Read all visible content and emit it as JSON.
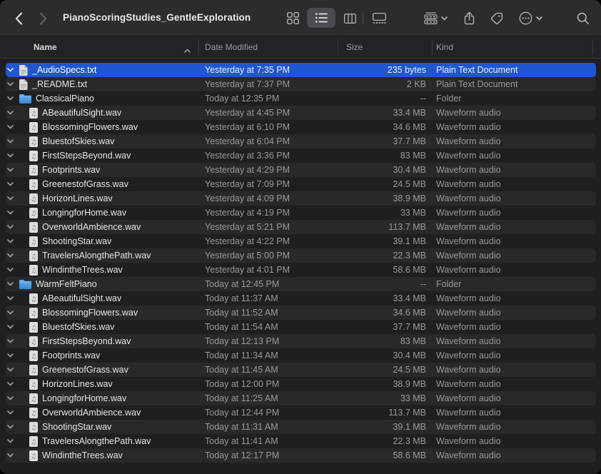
{
  "window": {
    "title": "PianoScoringStudies_GentleExploration"
  },
  "toolbar": {
    "buttons": [
      {
        "name": "back",
        "icon": "chevron-left-icon"
      },
      {
        "name": "forward",
        "icon": "chevron-right-icon",
        "disabled": true
      },
      {
        "name": "icon-view",
        "icon": "grid-view-icon"
      },
      {
        "name": "list-view",
        "icon": "list-view-icon",
        "active": true
      },
      {
        "name": "column-view",
        "icon": "column-view-icon"
      },
      {
        "name": "gallery-view",
        "icon": "gallery-view-icon"
      },
      {
        "name": "group",
        "icon": "group-icon",
        "has_dropdown_chevron": true
      },
      {
        "name": "share",
        "icon": "share-icon"
      },
      {
        "name": "tags",
        "icon": "tag-icon"
      },
      {
        "name": "more-options",
        "icon": "ellipsis-circle-icon",
        "has_dropdown_chevron": true
      },
      {
        "name": "search",
        "icon": "search-icon"
      }
    ]
  },
  "columns": [
    {
      "label": "Name",
      "sort": "ascending"
    },
    {
      "label": "Date Modified"
    },
    {
      "label": "Size"
    },
    {
      "label": "Kind"
    }
  ],
  "rows": [
    {
      "name": "_AudioSpecs.txt",
      "icon": "plain-text-document",
      "indent": 0,
      "date": "Yesterday at 7:35 PM",
      "size": "235 bytes",
      "kind": "Plain Text Document",
      "selected": true
    },
    {
      "name": "_README.txt",
      "icon": "plain-text-document",
      "indent": 0,
      "date": "Yesterday at 7:37 PM",
      "size": "2 KB",
      "kind": "Plain Text Document"
    },
    {
      "name": "ClassicalPiano",
      "icon": "folder",
      "indent": 0,
      "expanded": true,
      "date": "Today at 12:35 PM",
      "size": "--",
      "kind": "Folder"
    },
    {
      "name": "ABeautifulSight.wav",
      "icon": "waveform-audio",
      "indent": 1,
      "date": "Yesterday at 4:45 PM",
      "size": "33.4 MB",
      "kind": "Waveform audio"
    },
    {
      "name": "BlossomingFlowers.wav",
      "icon": "waveform-audio",
      "indent": 1,
      "date": "Yesterday at 6:10 PM",
      "size": "34.6 MB",
      "kind": "Waveform audio"
    },
    {
      "name": "BluestofSkies.wav",
      "icon": "waveform-audio",
      "indent": 1,
      "date": "Yesterday at 6:04 PM",
      "size": "37.7 MB",
      "kind": "Waveform audio"
    },
    {
      "name": "FirstStepsBeyond.wav",
      "icon": "waveform-audio",
      "indent": 1,
      "date": "Yesterday at 3:36 PM",
      "size": "83 MB",
      "kind": "Waveform audio"
    },
    {
      "name": "Footprints.wav",
      "icon": "waveform-audio",
      "indent": 1,
      "date": "Yesterday at 4:29 PM",
      "size": "30.4 MB",
      "kind": "Waveform audio"
    },
    {
      "name": "GreenestofGrass.wav",
      "icon": "waveform-audio",
      "indent": 1,
      "date": "Yesterday at 7:09 PM",
      "size": "24.5 MB",
      "kind": "Waveform audio"
    },
    {
      "name": "HorizonLines.wav",
      "icon": "waveform-audio",
      "indent": 1,
      "date": "Yesterday at 4:09 PM",
      "size": "38.9 MB",
      "kind": "Waveform audio"
    },
    {
      "name": "LongingforHome.wav",
      "icon": "waveform-audio",
      "indent": 1,
      "date": "Yesterday at 4:19 PM",
      "size": "33 MB",
      "kind": "Waveform audio"
    },
    {
      "name": "OverworldAmbience.wav",
      "icon": "waveform-audio",
      "indent": 1,
      "date": "Yesterday at 5:21 PM",
      "size": "113.7 MB",
      "kind": "Waveform audio"
    },
    {
      "name": "ShootingStar.wav",
      "icon": "waveform-audio",
      "indent": 1,
      "date": "Yesterday at 4:22 PM",
      "size": "39.1 MB",
      "kind": "Waveform audio"
    },
    {
      "name": "TravelersAlongthePath.wav",
      "icon": "waveform-audio",
      "indent": 1,
      "date": "Yesterday at 5:00 PM",
      "size": "22.3 MB",
      "kind": "Waveform audio"
    },
    {
      "name": "WindintheTrees.wav",
      "icon": "waveform-audio",
      "indent": 1,
      "date": "Yesterday at 4:01 PM",
      "size": "58.6 MB",
      "kind": "Waveform audio"
    },
    {
      "name": "WarmFeltPiano",
      "icon": "folder",
      "indent": 0,
      "expanded": true,
      "date": "Today at 12:45 PM",
      "size": "--",
      "kind": "Folder"
    },
    {
      "name": "ABeautifulSight.wav",
      "icon": "waveform-audio",
      "indent": 1,
      "date": "Today at 11:37 AM",
      "size": "33.4 MB",
      "kind": "Waveform audio"
    },
    {
      "name": "BlossomingFlowers.wav",
      "icon": "waveform-audio",
      "indent": 1,
      "date": "Today at 11:52 AM",
      "size": "34.6 MB",
      "kind": "Waveform audio"
    },
    {
      "name": "BluestofSkies.wav",
      "icon": "waveform-audio",
      "indent": 1,
      "date": "Today at 11:54 AM",
      "size": "37.7 MB",
      "kind": "Waveform audio"
    },
    {
      "name": "FirstStepsBeyond.wav",
      "icon": "waveform-audio",
      "indent": 1,
      "date": "Today at 12:13 PM",
      "size": "83 MB",
      "kind": "Waveform audio"
    },
    {
      "name": "Footprints.wav",
      "icon": "waveform-audio",
      "indent": 1,
      "date": "Today at 11:34 AM",
      "size": "30.4 MB",
      "kind": "Waveform audio"
    },
    {
      "name": "GreenestofGrass.wav",
      "icon": "waveform-audio",
      "indent": 1,
      "date": "Today at 11:45 AM",
      "size": "24.5 MB",
      "kind": "Waveform audio"
    },
    {
      "name": "HorizonLines.wav",
      "icon": "waveform-audio",
      "indent": 1,
      "date": "Today at 12:00 PM",
      "size": "38.9 MB",
      "kind": "Waveform audio"
    },
    {
      "name": "LongingforHome.wav",
      "icon": "waveform-audio",
      "indent": 1,
      "date": "Today at 11:25 AM",
      "size": "33 MB",
      "kind": "Waveform audio"
    },
    {
      "name": "OverworldAmbience.wav",
      "icon": "waveform-audio",
      "indent": 1,
      "date": "Today at 12:44 PM",
      "size": "113.7 MB",
      "kind": "Waveform audio"
    },
    {
      "name": "ShootingStar.wav",
      "icon": "waveform-audio",
      "indent": 1,
      "date": "Today at 11:31 AM",
      "size": "39.1 MB",
      "kind": "Waveform audio"
    },
    {
      "name": "TravelersAlongthePath.wav",
      "icon": "waveform-audio",
      "indent": 1,
      "date": "Today at 11:41 AM",
      "size": "22.3 MB",
      "kind": "Waveform audio"
    },
    {
      "name": "WindintheTrees.wav",
      "icon": "waveform-audio",
      "indent": 1,
      "date": "Today at 12:17 PM",
      "size": "58.6 MB",
      "kind": "Waveform audio"
    }
  ],
  "colors": {
    "selection": "#2057d0",
    "window_chrome": "#2c2b2e",
    "list_background": "#1f1e21",
    "row_stripe": "#29292c",
    "folder_blue": "#4aa1e8",
    "primary_text": "#e6e6e8",
    "secondary_text": "#98989e"
  }
}
